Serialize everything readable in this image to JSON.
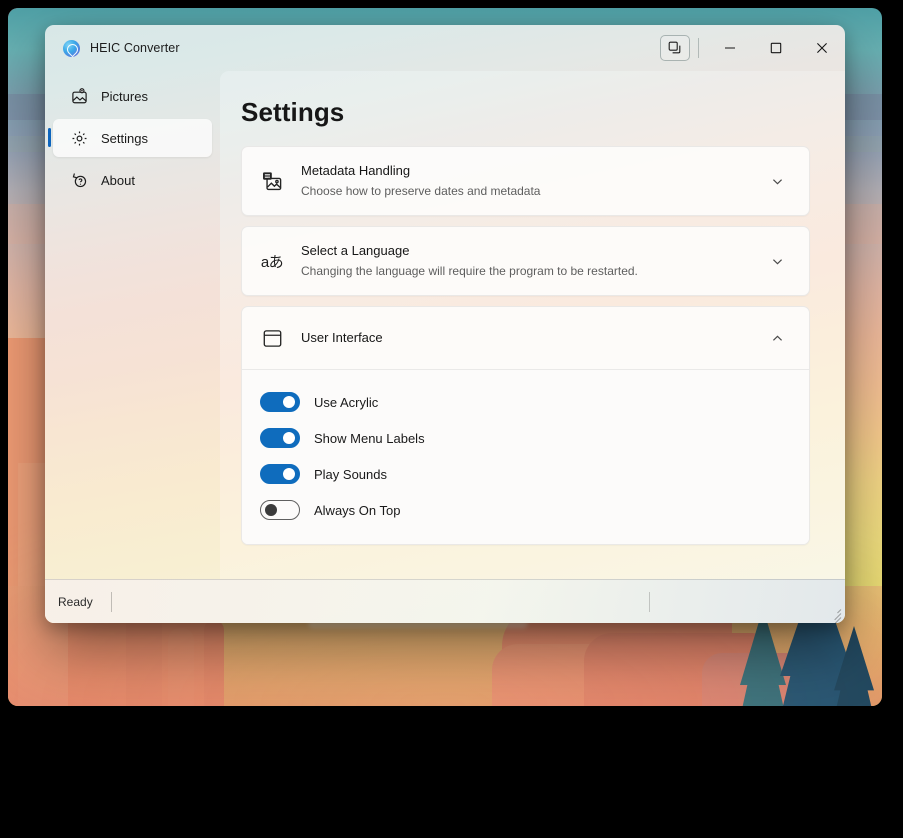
{
  "window": {
    "title": "HEIC Converter",
    "app_icon": "app-logo-icon",
    "titlebar_buttons": {
      "extra": "restore-windows-icon",
      "minimize": "minimize-icon",
      "maximize": "maximize-icon",
      "close": "close-icon"
    }
  },
  "sidebar": {
    "items": [
      {
        "label": "Pictures",
        "icon": "pictures-icon",
        "selected": false
      },
      {
        "label": "Settings",
        "icon": "gear-icon",
        "selected": true
      },
      {
        "label": "About",
        "icon": "help-circle-icon",
        "selected": false
      }
    ],
    "accent_color": "#0d65bd"
  },
  "main": {
    "page_title": "Settings",
    "cards": [
      {
        "icon": "image-metadata-icon",
        "title": "Metadata Handling",
        "subtitle": "Choose how to preserve dates and metadata",
        "expanded": false,
        "chevron": "chevron-down-icon"
      },
      {
        "icon": "translate-icon",
        "icon_text": "aあ",
        "title": "Select a Language",
        "subtitle": "Changing the language will require the program to be restarted.",
        "expanded": false,
        "chevron": "chevron-down-icon"
      },
      {
        "icon": "window-ui-icon",
        "title": "User Interface",
        "subtitle": "",
        "expanded": true,
        "chevron": "chevron-up-icon",
        "toggles": [
          {
            "label": "Use Acrylic",
            "on": true
          },
          {
            "label": "Show Menu Labels",
            "on": true
          },
          {
            "label": "Play Sounds",
            "on": true
          },
          {
            "label": "Always On Top",
            "on": false
          }
        ]
      }
    ],
    "toggle_on_color": "#0f6cbd"
  },
  "statusbar": {
    "status": "Ready",
    "resize_grip": "resize-grip-icon"
  }
}
